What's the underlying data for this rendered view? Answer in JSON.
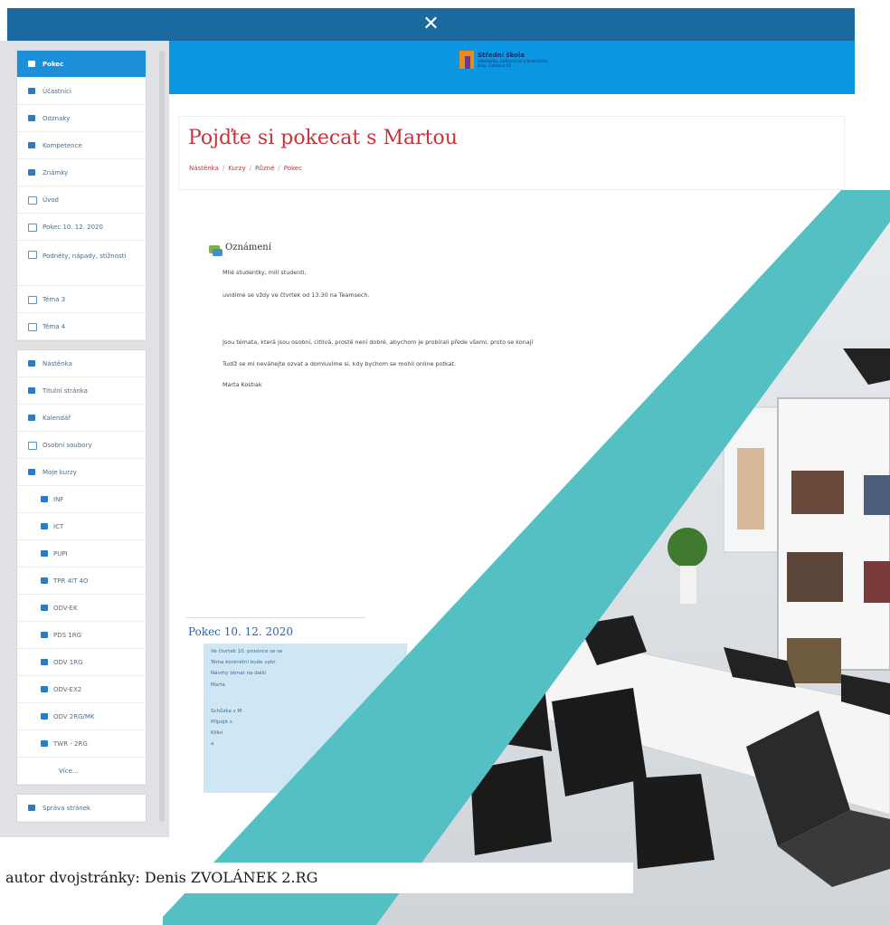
{
  "topbar": {
    "close_glyph": "✕"
  },
  "header": {
    "logo": {
      "line1": "Střední škola",
      "line2": "informatiky, poštovnictví a finančnictví",
      "line3": "Brno, Čichnova 23"
    }
  },
  "sidebar": {
    "course_items": [
      {
        "label": "Pokec",
        "icon": "graduation-cap-icon",
        "active": true
      },
      {
        "label": "Účastníci",
        "icon": "users-icon"
      },
      {
        "label": "Odznaky",
        "icon": "badge-icon"
      },
      {
        "label": "Kompetence",
        "icon": "checkmark-icon"
      },
      {
        "label": "Známky",
        "icon": "table-icon"
      },
      {
        "label": "Úvod",
        "icon": "folder-icon"
      },
      {
        "label": "Pokec 10. 12. 2020",
        "icon": "folder-icon"
      },
      {
        "label": "Podněty, nápady, stížnosti",
        "icon": "folder-icon"
      },
      {
        "label": "Téma 3",
        "icon": "folder-icon"
      },
      {
        "label": "Téma 4",
        "icon": "folder-icon"
      }
    ],
    "nav_items": [
      {
        "label": "Nástěnka",
        "icon": "dashboard-icon"
      },
      {
        "label": "Titulní stránka",
        "icon": "home-icon"
      },
      {
        "label": "Kalendář",
        "icon": "calendar-icon"
      },
      {
        "label": "Osobní soubory",
        "icon": "file-icon"
      },
      {
        "label": "Moje kurzy",
        "icon": "graduation-cap-icon"
      }
    ],
    "my_courses": [
      "INF",
      "ICT",
      "PUPI",
      "TPR 4IT 4O",
      "ODV-EK",
      "PDS 1RG",
      "ODV 1RG",
      "ODV-EX2",
      "ODV 2RG/MK",
      "TWR - 2RG"
    ],
    "more_label": "Více...",
    "admin_item": {
      "label": "Správa stránek",
      "icon": "wrench-icon"
    }
  },
  "page": {
    "title": "Pojďte si pokecat s Martou",
    "breadcrumbs": [
      "Nástěnka",
      "Kurzy",
      "Různé",
      "Pokec"
    ]
  },
  "announcement": {
    "heading": "Oznámení",
    "lines": [
      "Milé studentky, milí studenti,",
      "uvidíme se vždy ve čtvrtek od 13:30 na Teamsech.",
      "Jsou témata, která jsou osobní, citlivá, prostě není dobré, abychom je probírali přede všemi, proto se konají",
      "Tudíž se mi neváhejte ozvat a domluvíme si, kdy bychom se mohli online potkat.",
      "Marta Kostiak"
    ]
  },
  "section": {
    "title": "Pokec 10. 12. 2020",
    "lines": [
      "Ve čtvrtek 10. prosince se se",
      "Téma konkrétní bude vybr",
      "Návrhy témat na další",
      "Marta",
      "Schůzka v M",
      "Připojit s",
      "Klikn",
      "a"
    ]
  },
  "caption": {
    "text": "autor dvojstránky: Denis ZVOLÁNEK 2.RG"
  },
  "colors": {
    "topbar": "#1a6aa0",
    "header": "#0a96e1",
    "active_item": "#1d8ed8",
    "title": "#c6333b",
    "diagonal_band": "#55c0c4"
  }
}
